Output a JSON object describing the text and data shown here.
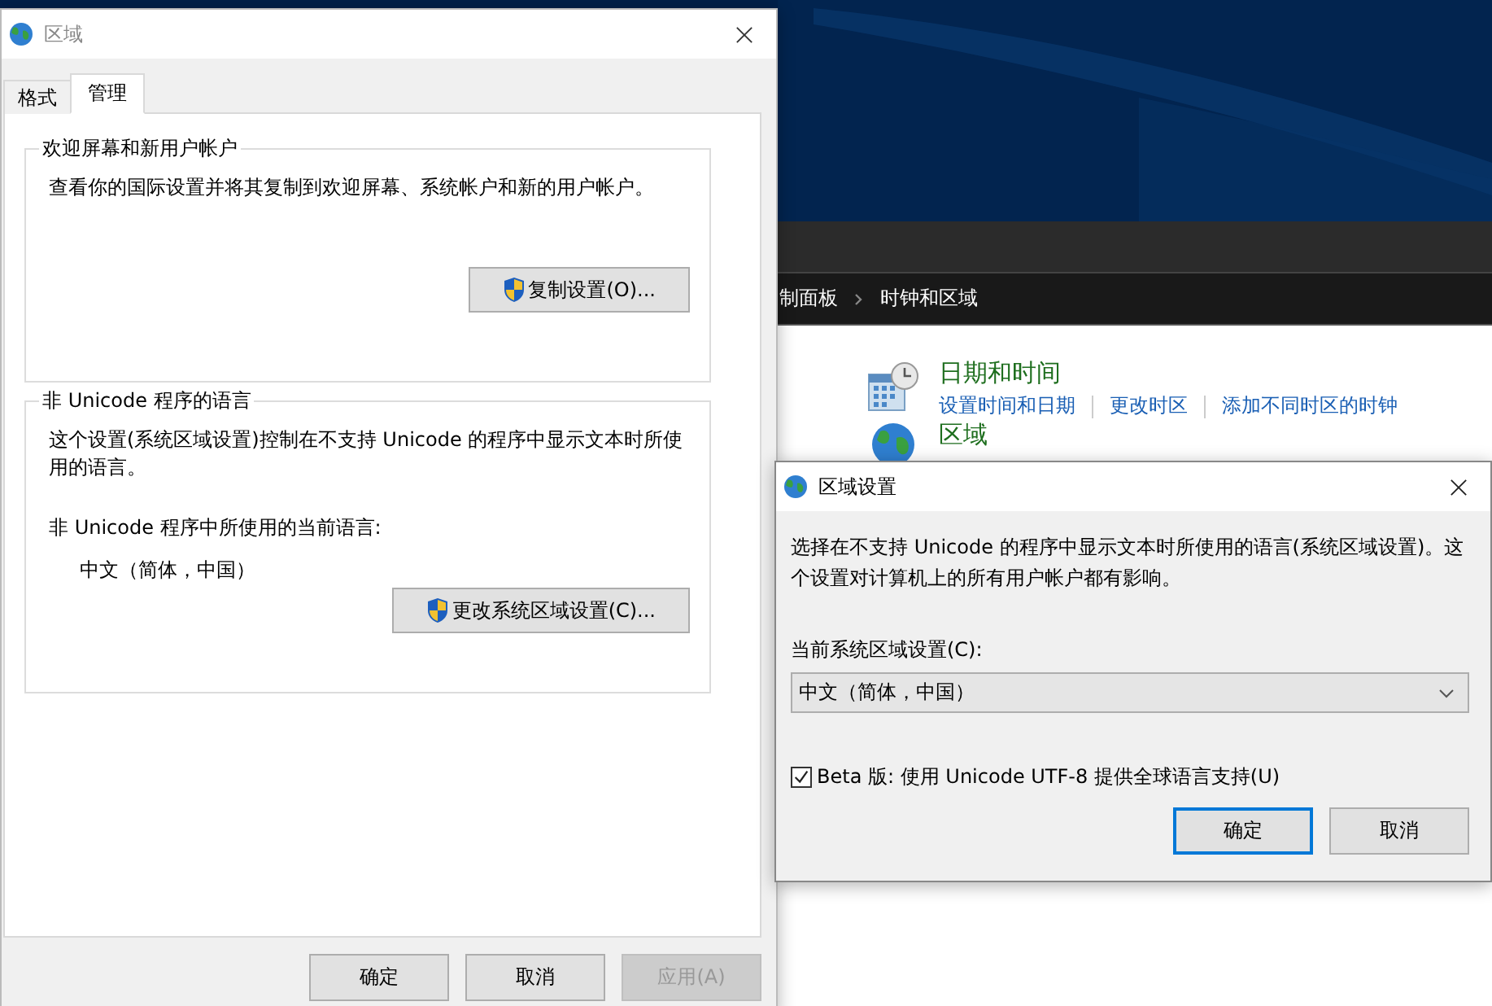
{
  "control_panel": {
    "breadcrumb": [
      "制面板",
      "时钟和区域"
    ],
    "categories": [
      {
        "kind": "clock",
        "title": "日期和时间",
        "links": [
          "设置时间和日期",
          "更改时区",
          "添加不同时区的时钟"
        ]
      },
      {
        "kind": "globe",
        "title": "区域"
      }
    ]
  },
  "region_window": {
    "title": "区域",
    "tabs": [
      {
        "label": "格式",
        "selected": false
      },
      {
        "label": "管理",
        "selected": true
      }
    ],
    "groups": [
      {
        "title": "欢迎屏幕和新用户帐户",
        "description": "查看你的国际设置并将其复制到欢迎屏幕、系统帐户和新的用户帐户。",
        "button": "复制设置(O)..."
      },
      {
        "title": "非 Unicode 程序的语言",
        "description": "这个设置(系统区域设置)控制在不支持 Unicode 的程序中显示文本时所使用的语言。",
        "current_label": "非 Unicode 程序中所使用的当前语言:",
        "current_value": "中文（简体，中国）",
        "button": "更改系统区域设置(C)..."
      }
    ],
    "buttons": [
      {
        "label": "确定",
        "disabled": false
      },
      {
        "label": "取消",
        "disabled": false
      },
      {
        "label": "应用(A)",
        "disabled": true
      }
    ]
  },
  "locale_dialog": {
    "title": "区域设置",
    "description": "选择在不支持 Unicode 的程序中显示文本时所使用的语言(系统区域设置)。这个设置对计算机上的所有用户帐户都有影响。",
    "locale_label": "当前系统区域设置(C):",
    "locale_value": "中文（简体，中国）",
    "beta_option": {
      "label": "Beta 版: 使用 Unicode UTF-8 提供全球语言支持(U)",
      "checked": true
    },
    "buttons": [
      {
        "label": "确定",
        "focused": true
      },
      {
        "label": "取消",
        "focused": false
      }
    ]
  }
}
